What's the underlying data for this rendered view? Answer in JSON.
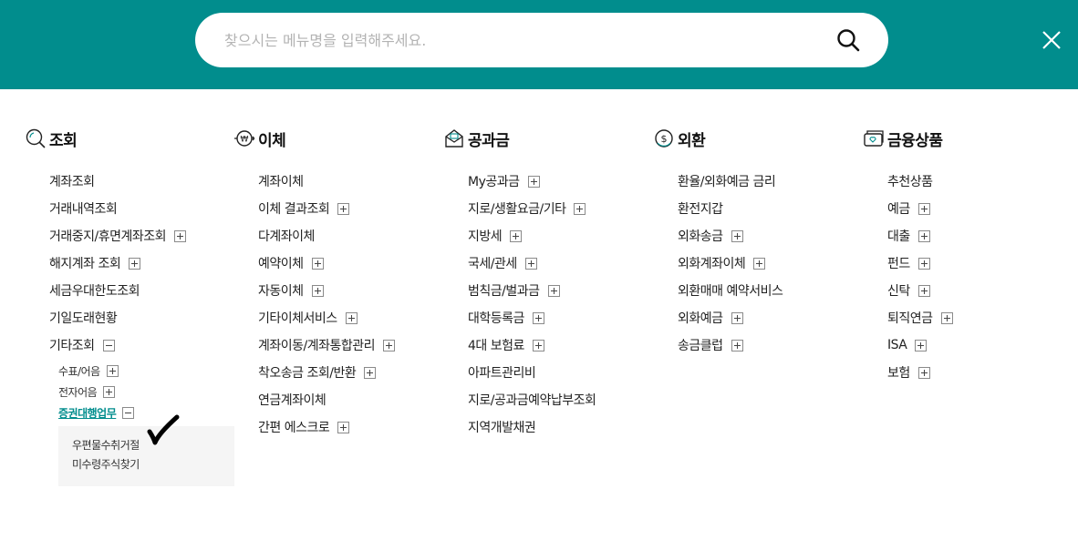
{
  "search": {
    "placeholder": "찾으시는 메뉴명을 입력해주세요.",
    "icon": "search-icon"
  },
  "close": {
    "icon": "close-icon"
  },
  "colors": {
    "brand": "#018d8d",
    "active": "#018d8d"
  },
  "columns": [
    {
      "title": "조회",
      "icon": "inquiry-icon",
      "items": [
        {
          "label": "계좌조회",
          "toggle": ""
        },
        {
          "label": "거래내역조회",
          "toggle": ""
        },
        {
          "label": "거래중지/휴면계좌조회",
          "toggle": "plus"
        },
        {
          "label": "해지계좌 조회",
          "toggle": "plus"
        },
        {
          "label": "세금우대한도조회",
          "toggle": ""
        },
        {
          "label": "기일도래현황",
          "toggle": ""
        },
        {
          "label": "기타조회",
          "toggle": "minus"
        }
      ],
      "subitems": [
        {
          "label": "수표/어음",
          "toggle": "plus"
        },
        {
          "label": "전자어음",
          "toggle": "plus"
        },
        {
          "label": "증권대행업무",
          "toggle": "minus",
          "active": true
        }
      ],
      "subsubitems": [
        "우편물수취거절",
        "미수령주식찾기"
      ]
    },
    {
      "title": "이체",
      "icon": "transfer-icon",
      "items": [
        {
          "label": "계좌이체",
          "toggle": ""
        },
        {
          "label": "이체 결과조회",
          "toggle": "plus"
        },
        {
          "label": "다계좌이체",
          "toggle": ""
        },
        {
          "label": "예약이체",
          "toggle": "plus"
        },
        {
          "label": "자동이체",
          "toggle": "plus"
        },
        {
          "label": "기타이체서비스",
          "toggle": "plus"
        },
        {
          "label": "계좌이동/계좌통합관리",
          "toggle": "plus"
        },
        {
          "label": "착오송금 조회/반환",
          "toggle": "plus"
        },
        {
          "label": "연금계좌이체",
          "toggle": ""
        },
        {
          "label": "간편 에스크로",
          "toggle": "plus"
        }
      ]
    },
    {
      "title": "공과금",
      "icon": "bill-icon",
      "items": [
        {
          "label": "My공과금",
          "toggle": "plus"
        },
        {
          "label": "지로/생활요금/기타",
          "toggle": "plus"
        },
        {
          "label": "지방세",
          "toggle": "plus"
        },
        {
          "label": "국세/관세",
          "toggle": "plus"
        },
        {
          "label": "범칙금/벌과금",
          "toggle": "plus"
        },
        {
          "label": "대학등록금",
          "toggle": "plus"
        },
        {
          "label": "4대 보험료",
          "toggle": "plus"
        },
        {
          "label": "아파트관리비",
          "toggle": ""
        },
        {
          "label": "지로/공과금예약납부조회",
          "toggle": ""
        },
        {
          "label": "지역개발채권",
          "toggle": ""
        }
      ]
    },
    {
      "title": "외환",
      "icon": "exchange-icon",
      "items": [
        {
          "label": "환율/외화예금 금리",
          "toggle": ""
        },
        {
          "label": "환전지갑",
          "toggle": ""
        },
        {
          "label": "외화송금",
          "toggle": "plus"
        },
        {
          "label": "외화계좌이체",
          "toggle": "plus"
        },
        {
          "label": "외환매매 예약서비스",
          "toggle": ""
        },
        {
          "label": "외화예금",
          "toggle": "plus"
        },
        {
          "label": "송금클럽",
          "toggle": "plus"
        }
      ]
    },
    {
      "title": "금융상품",
      "icon": "product-icon",
      "items": [
        {
          "label": "추천상품",
          "toggle": ""
        },
        {
          "label": "예금",
          "toggle": "plus"
        },
        {
          "label": "대출",
          "toggle": "plus"
        },
        {
          "label": "펀드",
          "toggle": "plus"
        },
        {
          "label": "신탁",
          "toggle": "plus"
        },
        {
          "label": "퇴직연금",
          "toggle": "plus"
        },
        {
          "label": "ISA",
          "toggle": "plus"
        },
        {
          "label": "보험",
          "toggle": "plus"
        }
      ]
    }
  ]
}
